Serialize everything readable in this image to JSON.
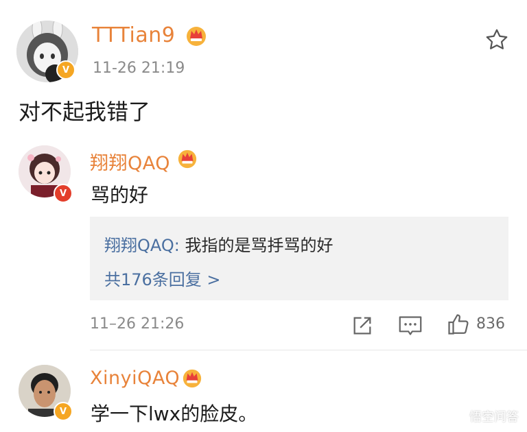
{
  "colors": {
    "username": "#e8833a",
    "time": "#8a8a8a",
    "link_blue": "#4a6fa0",
    "quote_bg": "#f2f2f2",
    "vip_badge": "#f5a623",
    "red_badge": "#e33e2b"
  },
  "post": {
    "username": "TTTian9",
    "time": "11-26 21:19",
    "content": "对不起我错了",
    "favorite_icon": "star-icon"
  },
  "comments": [
    {
      "username": "翔翔QAQ",
      "content": "骂的好",
      "time": "11–26 21:26",
      "reply_preview": {
        "author": "翔翔QAQ:",
        "text": " 我指的是骂抙骂的好",
        "more_link": "共176条回复 >"
      },
      "actions": {
        "share_icon": "share-icon",
        "comment_icon": "comment-icon",
        "like_icon": "thumbs-up-icon",
        "like_count": "836"
      }
    },
    {
      "username": "XinyiQAQ",
      "content": "学一下lwx的脸皮。"
    }
  ],
  "watermark": "悟空问答"
}
